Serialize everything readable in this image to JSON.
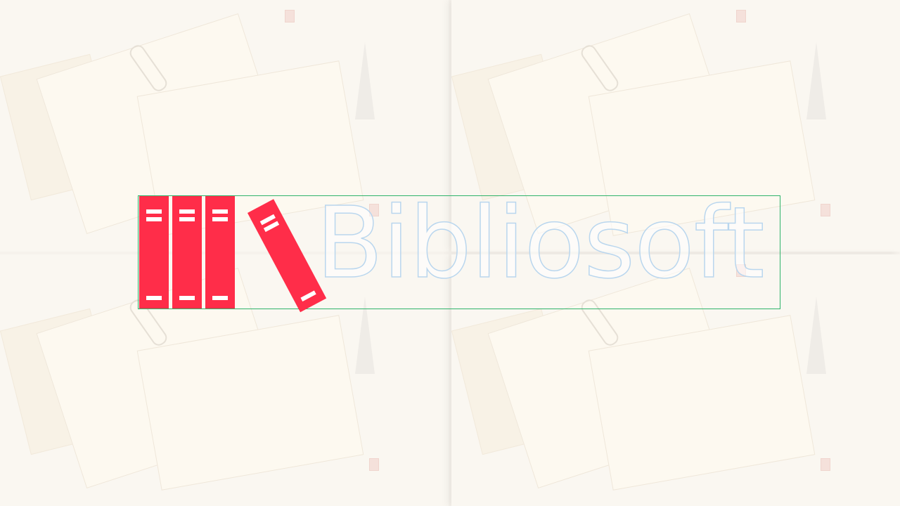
{
  "logo": {
    "icon": "books-icon",
    "text": "Bibliosoft",
    "accent_color": "#ff2d49",
    "text_outline_color": "#b9d6ee",
    "frame_color": "#2fb36a"
  },
  "background": {
    "description_icon": "vintage-postcards-wallpaper",
    "tile_color": "#faf7f1"
  }
}
